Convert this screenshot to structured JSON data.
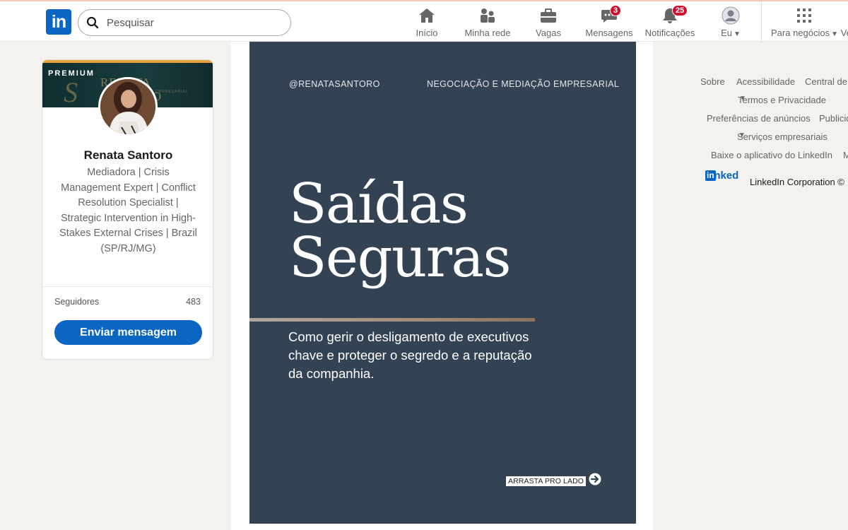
{
  "nav": {
    "search_placeholder": "Pesquisar",
    "items": [
      {
        "label": "Início",
        "icon": "home-icon"
      },
      {
        "label": "Minha rede",
        "icon": "network-icon"
      },
      {
        "label": "Vagas",
        "icon": "briefcase-icon"
      },
      {
        "label": "Mensagens",
        "icon": "messaging-icon",
        "badge": "3"
      },
      {
        "label": "Notificações",
        "icon": "bell-icon",
        "badge": "25"
      },
      {
        "label": "Eu",
        "icon": "avatar"
      },
      {
        "label": "Para negócios",
        "icon": "grid-icon"
      }
    ],
    "overflow_label": "Ve"
  },
  "profile": {
    "premium_label": "PREMIUM",
    "cover_brand": "RENATA SANTORO",
    "cover_subtitle": "EMPRESARIAL",
    "name": "Renata Santoro",
    "headline": "Mediadora | Crisis Management Expert | Conflict Resolution Specialist | Strategic Intervention in High-Stakes External Crises | Brazil (SP/RJ/MG)",
    "followers_label": "Seguidores",
    "followers_count": "483",
    "message_button": "Enviar mensagem"
  },
  "slide": {
    "handle": "@RENATASANTORO",
    "topic": "NEGOCIAÇÃO E MEDIAÇÃO EMPRESARIAL",
    "title_line1": "Saídas",
    "title_line2": "Seguras",
    "subtitle": "Como gerir o desligamento de executivos chave e proteger o segredo e a reputação da companhia.",
    "swipe_label": "ARRASTA PRO LADO"
  },
  "footer": {
    "about": "Sobre",
    "accessibility": "Acessibilidade",
    "help_center": "Central de",
    "terms": "Termos e Privacidade",
    "ad_prefs": "Preferências de anúncios",
    "advertising": "Publicid",
    "business_services": "Serviços empresariais",
    "get_app": "Baixe o aplicativo do LinkedIn",
    "more": "M",
    "brand": "Linked",
    "brand_in": "in",
    "corporation": "LinkedIn Corporation ©"
  },
  "colors": {
    "brand_blue": "#0a66c2",
    "slide_bg": "#334354",
    "badge_red": "#cb112d",
    "page_bg": "#f4f2ee"
  }
}
